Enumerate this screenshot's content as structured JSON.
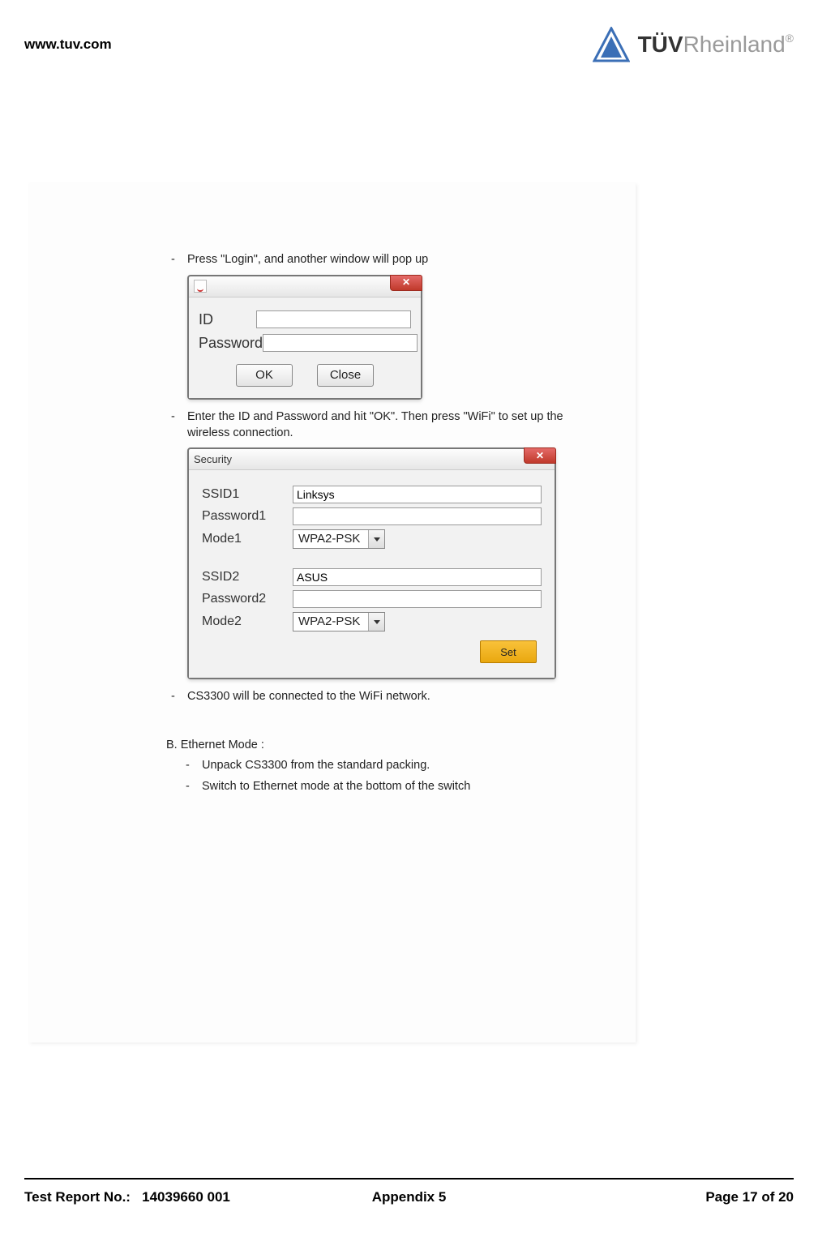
{
  "header": {
    "url": "www.tuv.com",
    "brand_bold": "TÜV",
    "brand_light": "Rheinland",
    "registered": "®"
  },
  "content": {
    "bullet1": "Press \"Login\", and another window will pop up",
    "bullet2": "Enter the ID and Password and hit \"OK\". Then press \"WiFi\" to set up the wireless connection.",
    "bullet3": "CS3300 will be connected to the WiFi network.",
    "sectionB_title": "B.   Ethernet Mode :",
    "sectionB_items": [
      "Unpack CS3300 from the standard packing.",
      "Switch to Ethernet mode at the bottom of the switch"
    ]
  },
  "login_dialog": {
    "id_label": "ID",
    "password_label": "Password",
    "id_value": "",
    "password_value": "",
    "ok_label": "OK",
    "close_label": "Close"
  },
  "security_dialog": {
    "title": "Security",
    "ssid1_label": "SSID1",
    "ssid1_value": "Linksys",
    "password1_label": "Password1",
    "password1_value": "",
    "mode1_label": "Mode1",
    "mode1_value": "WPA2-PSK",
    "ssid2_label": "SSID2",
    "ssid2_value": "ASUS",
    "password2_label": "Password2",
    "password2_value": "",
    "mode2_label": "Mode2",
    "mode2_value": "WPA2-PSK",
    "set_label": "Set"
  },
  "footer": {
    "left_label": "Test Report No.:",
    "left_value": "14039660 001",
    "center": "Appendix 5",
    "right": "Page 17 of 20"
  }
}
